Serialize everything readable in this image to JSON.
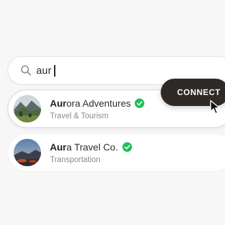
{
  "search": {
    "query": "aur",
    "icon": "search-icon"
  },
  "results": [
    {
      "name_match": "Aur",
      "name_rest": "ora Adventures",
      "category": "Travel & Tourism",
      "verified": true,
      "avatar": "mountain-landscape-image"
    },
    {
      "name_match": "Aur",
      "name_rest": "a Travel Co.",
      "category": "Transportation",
      "verified": true,
      "avatar": "sunset-landscape-image"
    }
  ],
  "connect_button": {
    "label": "CONNECT"
  },
  "colors": {
    "verified": "#1fc15a",
    "button_bg": "#2f2a26",
    "background": "#f7f7f7"
  }
}
